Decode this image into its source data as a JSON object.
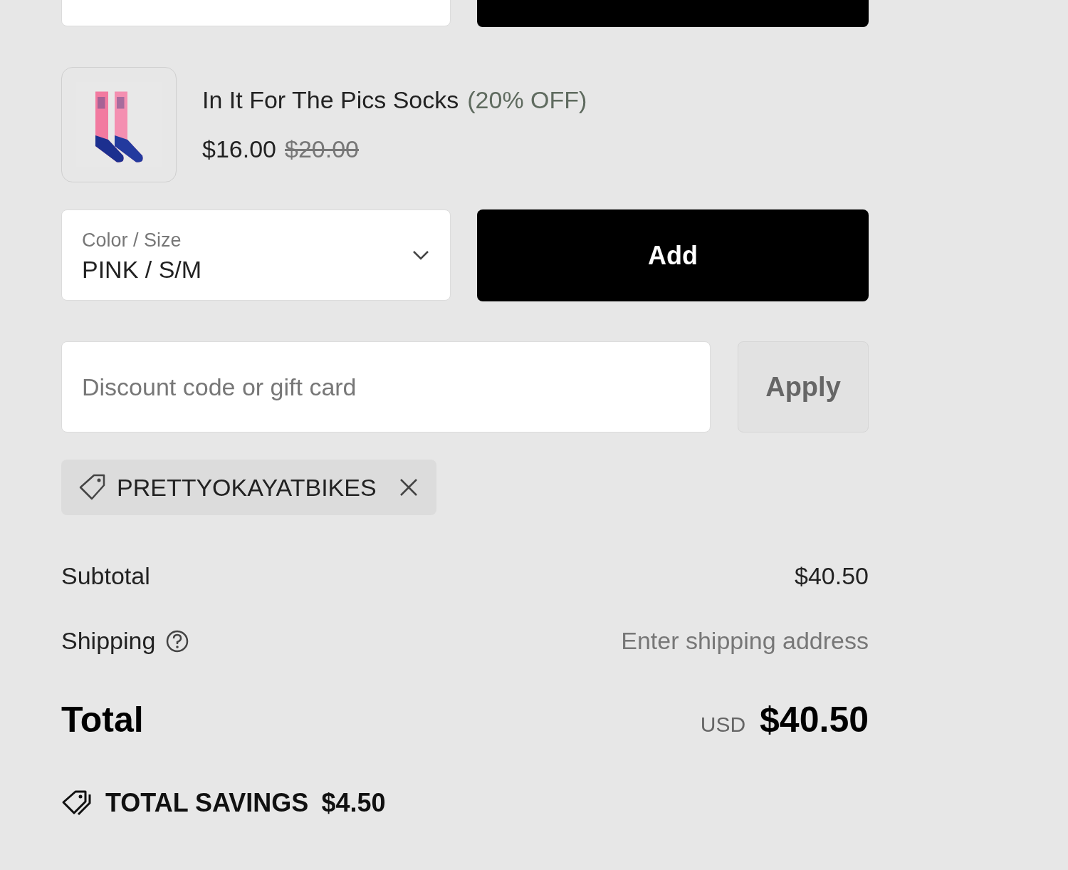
{
  "product": {
    "name": "In It For The Pics Socks",
    "discount": "(20% OFF)",
    "price": "$16.00",
    "original_price": "$20.00"
  },
  "variant_select": {
    "label": "Color / Size",
    "value": "PINK / S/M"
  },
  "add_button": "Add",
  "discount_field": {
    "placeholder": "Discount code or gift card"
  },
  "apply_button": "Apply",
  "applied_code": "PRETTYOKAYATBIKES",
  "summary": {
    "subtotal_label": "Subtotal",
    "subtotal": "$40.50",
    "shipping_label": "Shipping",
    "shipping": "Enter shipping address",
    "total_label": "Total",
    "currency": "USD",
    "total": "$40.50"
  },
  "savings": {
    "label": "TOTAL SAVINGS",
    "amount": "$4.50"
  }
}
